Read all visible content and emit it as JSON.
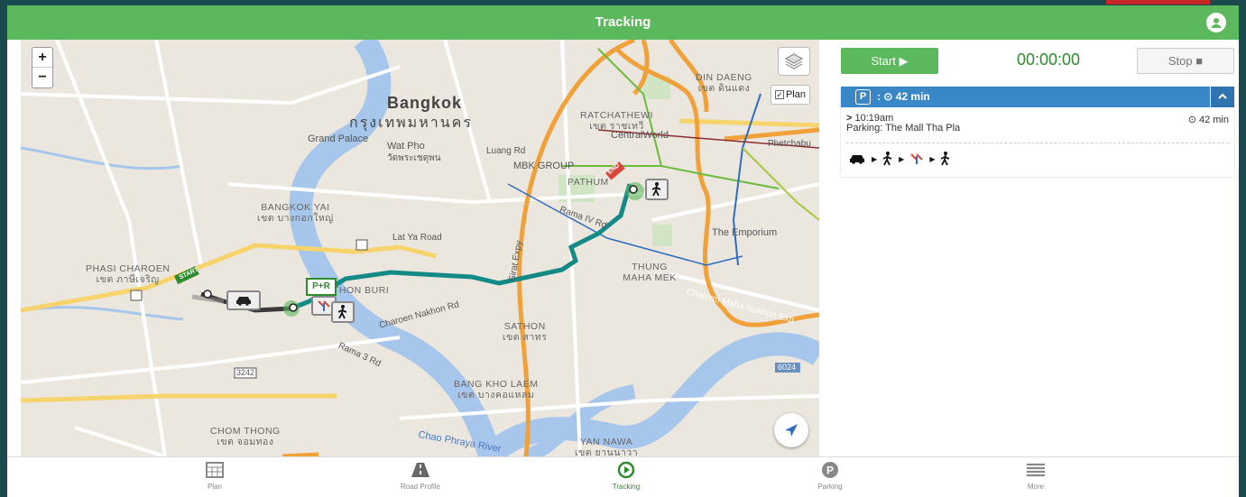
{
  "header": {
    "title": "Tracking"
  },
  "map": {
    "zoom_in": "+",
    "zoom_out": "−",
    "plan_label": "Plan",
    "labels": {
      "bangkok_en": "Bangkok",
      "bangkok_th": "กรุงเทพมหานคร",
      "grand_palace": "Grand Palace",
      "wat_pho": "Wat Pho",
      "wat_pho_th": "วัดพระเชตุพน",
      "bangkok_yai": "BANGKOK YAI",
      "bangkok_yai_th": "เขต บางกอกใหญ่",
      "phasi_charoen": "PHASI CHAROEN",
      "phasi_charoen_th": "เขต ภาษีเจริญ",
      "ratchathewi": "RATCHATHEWI",
      "ratchathewi_th": "เขต ราชเทวี",
      "din_daeng": "DIN DAENG",
      "din_daeng_th": "เขต ดินแดง",
      "centralworld": "CentralWorld",
      "mbk": "MBK GROUP",
      "pathum": "PATHUM",
      "the_emporium": "The Emporium",
      "thung_maha_mek": "THUNG MAHA MEK",
      "sathon": "SATHON",
      "sathon_th": "เขต สาทร",
      "bang_kho_laem": "BANG KHO LAEM",
      "bang_kho_laem_th": "เขต บางคอแหลม",
      "chom_thong": "CHOM THONG",
      "chom_thong_th": "เขต จอมทอง",
      "yan_nawa": "YAN NAWA",
      "yan_nawa_th": "เขต ยานนาวา",
      "chao_phraya": "Chao Phraya River",
      "rama_iv": "Rama IV Rd",
      "lat_ya": "Lat Ya Road",
      "charoen_nakhon": "Charoen Nakhon Rd",
      "thonburi": "THON BURI",
      "sirat_expy": "Sirat Expy",
      "chalerm": "Chalerm Maha Nakhon Exp",
      "phetchaburi": "Phetchabu",
      "rama3": "Rama 3 Rd",
      "luang_rd": "Luang Rd",
      "start": "START",
      "end": "END",
      "road_3242": "3242",
      "road_6024": "6024",
      "pr": "P+R"
    }
  },
  "controls": {
    "start_label": "Start ▶",
    "timer": "00:00:00",
    "stop_label": "Stop ■"
  },
  "trip": {
    "parking_symbol": "P",
    "duration": ": ⊙ 42 min",
    "time": "10:19am",
    "place": "Parking: The Mall Tha Pla",
    "right_duration": "⊙ 42 min"
  },
  "bottom_nav": [
    {
      "label": "Plan",
      "icon": "calendar-grid-icon"
    },
    {
      "label": "Road Profile",
      "icon": "road-icon"
    },
    {
      "label": "Tracking",
      "icon": "play-circle-icon"
    },
    {
      "label": "Parking",
      "icon": "parking-icon"
    },
    {
      "label": "More",
      "icon": "list-icon"
    }
  ],
  "colors": {
    "accent_green": "#5cb85c",
    "card_blue": "#3a87c8",
    "route_teal": "#138a86"
  }
}
